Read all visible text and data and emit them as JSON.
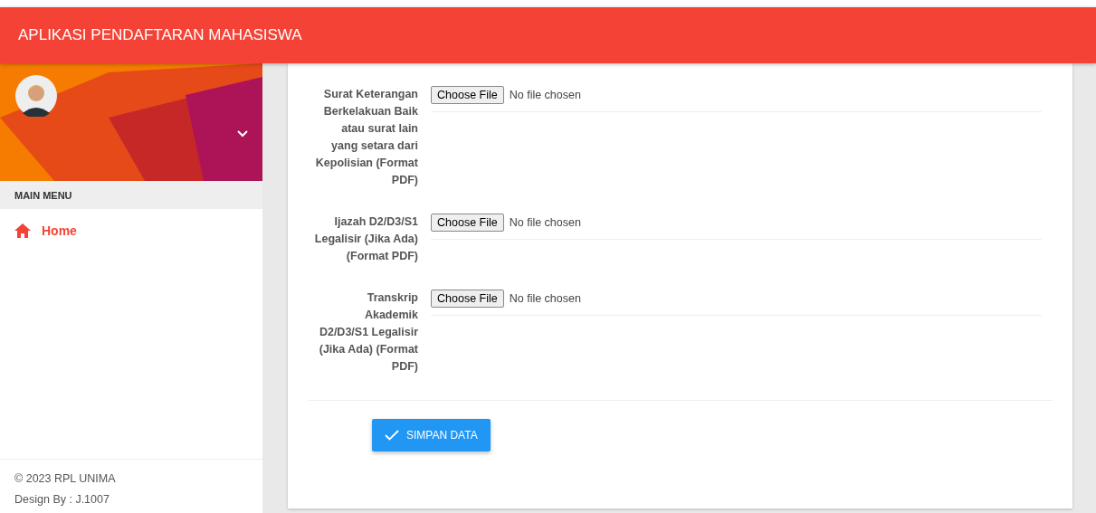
{
  "app_bar": {
    "title": "APLIKASI PENDAFTARAN MAHASISWA"
  },
  "sidebar": {
    "menu_header": "MAIN MENU",
    "items": [
      {
        "label": "Home",
        "selected": true
      }
    ],
    "footer": {
      "copyright": "© 2023 RPL UNIMA",
      "credit": "Design By : J.1007"
    }
  },
  "form": {
    "fields": [
      {
        "label": "Surat Keterangan Berkelakuan Baik atau surat lain yang setara dari Kepolisian (Format PDF)",
        "button": "Choose File",
        "status": "No file chosen"
      },
      {
        "label": "Ijazah D2/D3/S1 Legalisir (Jika Ada) (Format PDF)",
        "button": "Choose File",
        "status": "No file chosen"
      },
      {
        "label": "Transkrip Akademik D2/D3/S1 Legalisir (Jika Ada) (Format PDF)",
        "button": "Choose File",
        "status": "No file chosen"
      }
    ],
    "submit": "SIMPAN DATA"
  }
}
